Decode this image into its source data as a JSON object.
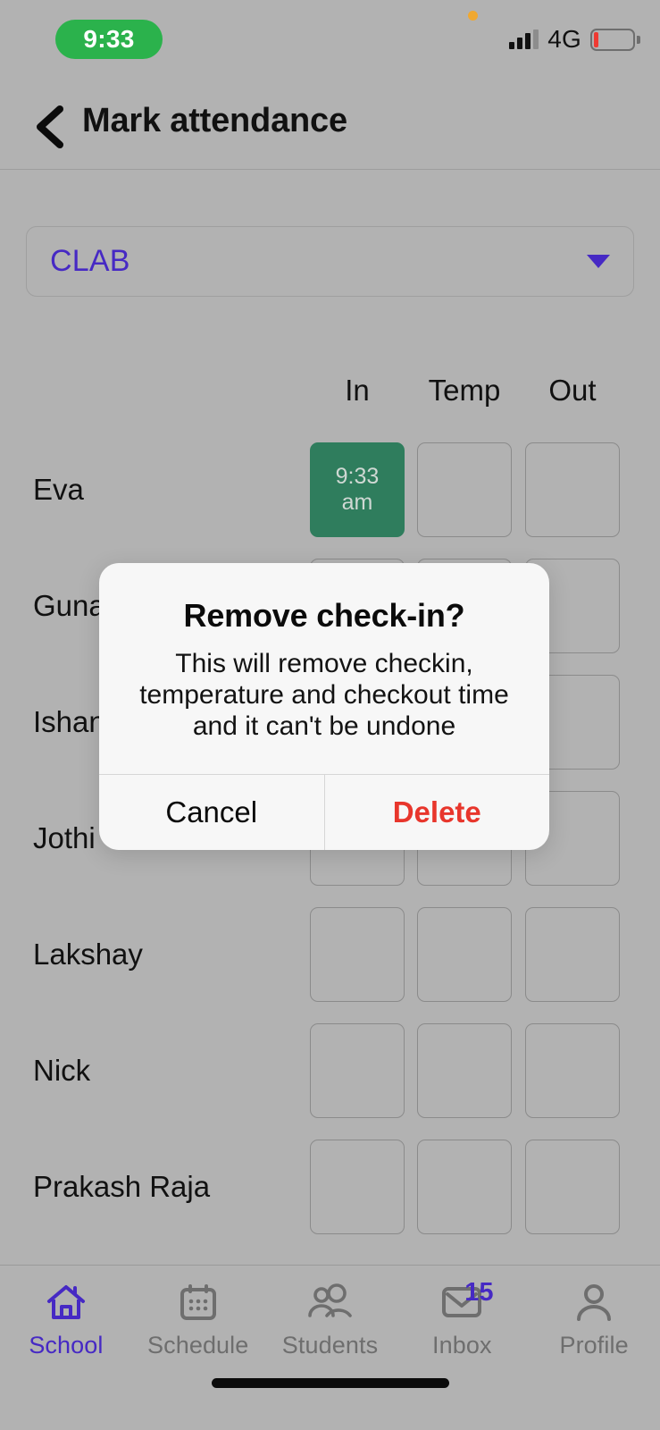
{
  "status_bar": {
    "time": "9:33",
    "network": "4G",
    "signal_icon": "signal-bars-icon",
    "battery_icon": "battery-low-icon",
    "privacy_icon": "privacy-indicator-dot"
  },
  "header": {
    "back_icon": "back-chevron-icon",
    "title": "Mark attendance"
  },
  "class_select": {
    "value": "CLAB",
    "caret_icon": "chevron-down-icon"
  },
  "table": {
    "columns": [
      "In",
      "Temp",
      "Out"
    ],
    "rows": [
      {
        "name": "Eva",
        "in": "9:33\nam",
        "in_filled": true,
        "temp": "",
        "out": ""
      },
      {
        "name": "Guna",
        "in": "",
        "in_filled": false,
        "temp": "",
        "out": ""
      },
      {
        "name": "Ishan",
        "in": "",
        "in_filled": false,
        "temp": "",
        "out": ""
      },
      {
        "name": "Jothi",
        "in": "",
        "in_filled": false,
        "temp": "",
        "out": ""
      },
      {
        "name": "Lakshay",
        "in": "",
        "in_filled": false,
        "temp": "",
        "out": ""
      },
      {
        "name": "Nick",
        "in": "",
        "in_filled": false,
        "temp": "",
        "out": ""
      },
      {
        "name": "Prakash Raja",
        "in": "",
        "in_filled": false,
        "temp": "",
        "out": ""
      }
    ],
    "checkin_time_value": "9:33",
    "checkin_time_meridiem": "am"
  },
  "dialog": {
    "title": "Remove check-in?",
    "message": "This will remove checkin, temperature and checkout time and it can't be undone",
    "cancel_label": "Cancel",
    "delete_label": "Delete"
  },
  "tabbar": {
    "items": [
      {
        "label": "School",
        "icon": "home-icon",
        "active": true
      },
      {
        "label": "Schedule",
        "icon": "calendar-icon",
        "active": false
      },
      {
        "label": "Students",
        "icon": "people-icon",
        "active": false
      },
      {
        "label": "Inbox",
        "icon": "envelope-icon",
        "active": false,
        "badge": "15"
      },
      {
        "label": "Profile",
        "icon": "person-icon",
        "active": false
      }
    ]
  },
  "colors": {
    "accent": "#4629c4",
    "checked_in": "#2f7d5d",
    "danger": "#e8362c",
    "time_pill": "#2bb24c",
    "background": "#b2b2b2"
  }
}
